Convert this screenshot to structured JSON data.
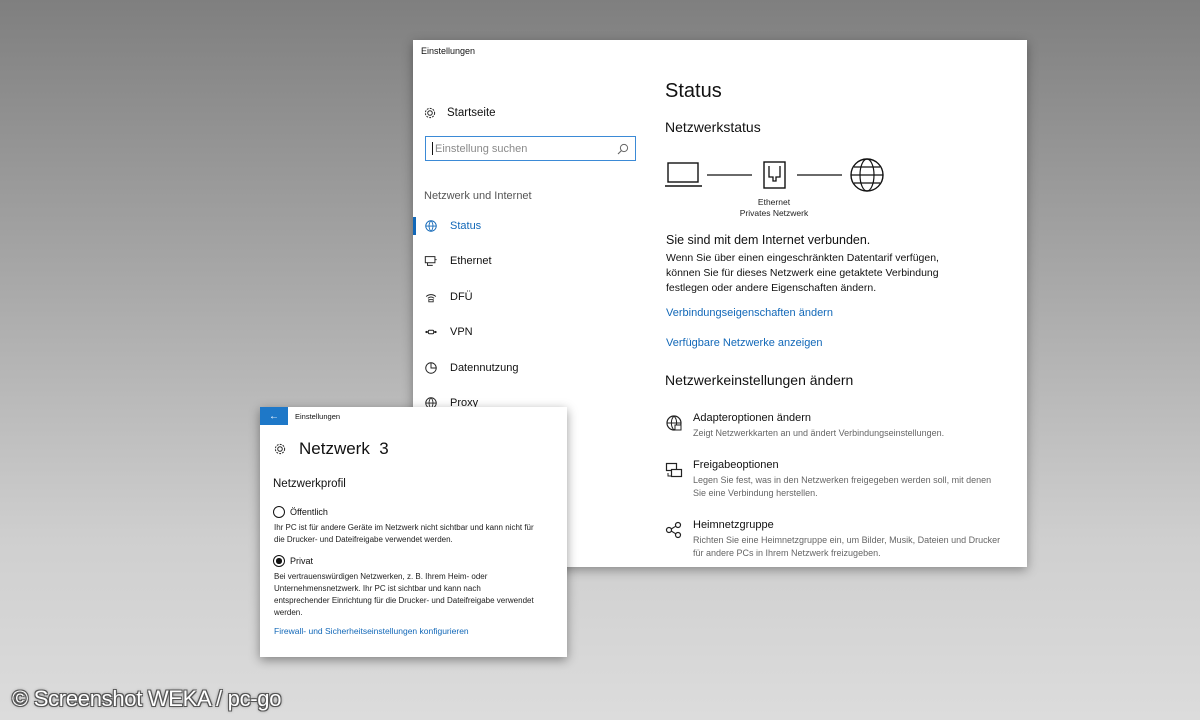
{
  "main_window": {
    "title": "Einstellungen",
    "sidebar": {
      "home_label": "Startseite",
      "search_placeholder": "Einstellung suchen",
      "section_title": "Netzwerk und Internet",
      "items": [
        {
          "label": "Status",
          "icon": "status-globe-icon",
          "active": true
        },
        {
          "label": "Ethernet",
          "icon": "ethernet-icon",
          "active": false
        },
        {
          "label": "DFÜ",
          "icon": "dialup-icon",
          "active": false
        },
        {
          "label": "VPN",
          "icon": "vpn-icon",
          "active": false
        },
        {
          "label": "Datennutzung",
          "icon": "data-usage-icon",
          "active": false
        },
        {
          "label": "Proxy",
          "icon": "proxy-globe-icon",
          "active": false
        }
      ]
    },
    "content": {
      "heading": "Status",
      "network_status_title": "Netzwerkstatus",
      "diagram": {
        "adapter_label": "Ethernet",
        "profile_label": "Privates Netzwerk"
      },
      "connected_text": "Sie sind mit dem Internet verbunden.",
      "description": "Wenn Sie über einen eingeschränkten Datentarif verfügen, können Sie für dieses Netzwerk eine getaktete Verbindung festlegen oder andere Eigenschaften ändern.",
      "link_connection_props": "Verbindungseigenschaften ändern",
      "link_available_networks": "Verfügbare Netzwerke anzeigen",
      "change_settings_title": "Netzwerkeinstellungen ändern",
      "options": [
        {
          "title": "Adapteroptionen ändern",
          "desc": "Zeigt Netzwerkkarten an und ändert Verbindungseinstellungen.",
          "icon": "adapter-icon"
        },
        {
          "title": "Freigabeoptionen",
          "desc": "Legen Sie fest, was in den Netzwerken freigegeben werden soll, mit denen Sie eine Verbindung herstellen.",
          "icon": "sharing-icon"
        },
        {
          "title": "Heimnetzgruppe",
          "desc": "Richten Sie eine Heimnetzgruppe ein, um Bilder, Musik, Dateien und Drucker für andere PCs in Ihrem Netzwerk freizugeben.",
          "icon": "homegroup-icon"
        }
      ]
    }
  },
  "network_window": {
    "title": "Einstellungen",
    "heading": "Netzwerk  3",
    "profile_title": "Netzwerkprofil",
    "public_label": "Öffentlich",
    "public_selected": false,
    "public_desc": "Ihr PC ist für andere Geräte im Netzwerk nicht sichtbar und kann nicht für die Drucker- und Dateifreigabe verwendet werden.",
    "private_label": "Privat",
    "private_selected": true,
    "private_desc": "Bei vertrauenswürdigen Netzwerken, z. B. Ihrem Heim- oder Unternehmensnetzwerk. Ihr PC ist sichtbar und kann nach entsprechender Einrichtung für die Drucker- und Dateifreigabe verwendet werden.",
    "firewall_link": "Firewall- und Sicherheitseinstellungen konfigurieren"
  },
  "watermark": "© Screenshot WEKA / pc-go",
  "colors": {
    "accent": "#1268b8",
    "back_button": "#1e78c8",
    "window_bg": "#ffffff"
  }
}
